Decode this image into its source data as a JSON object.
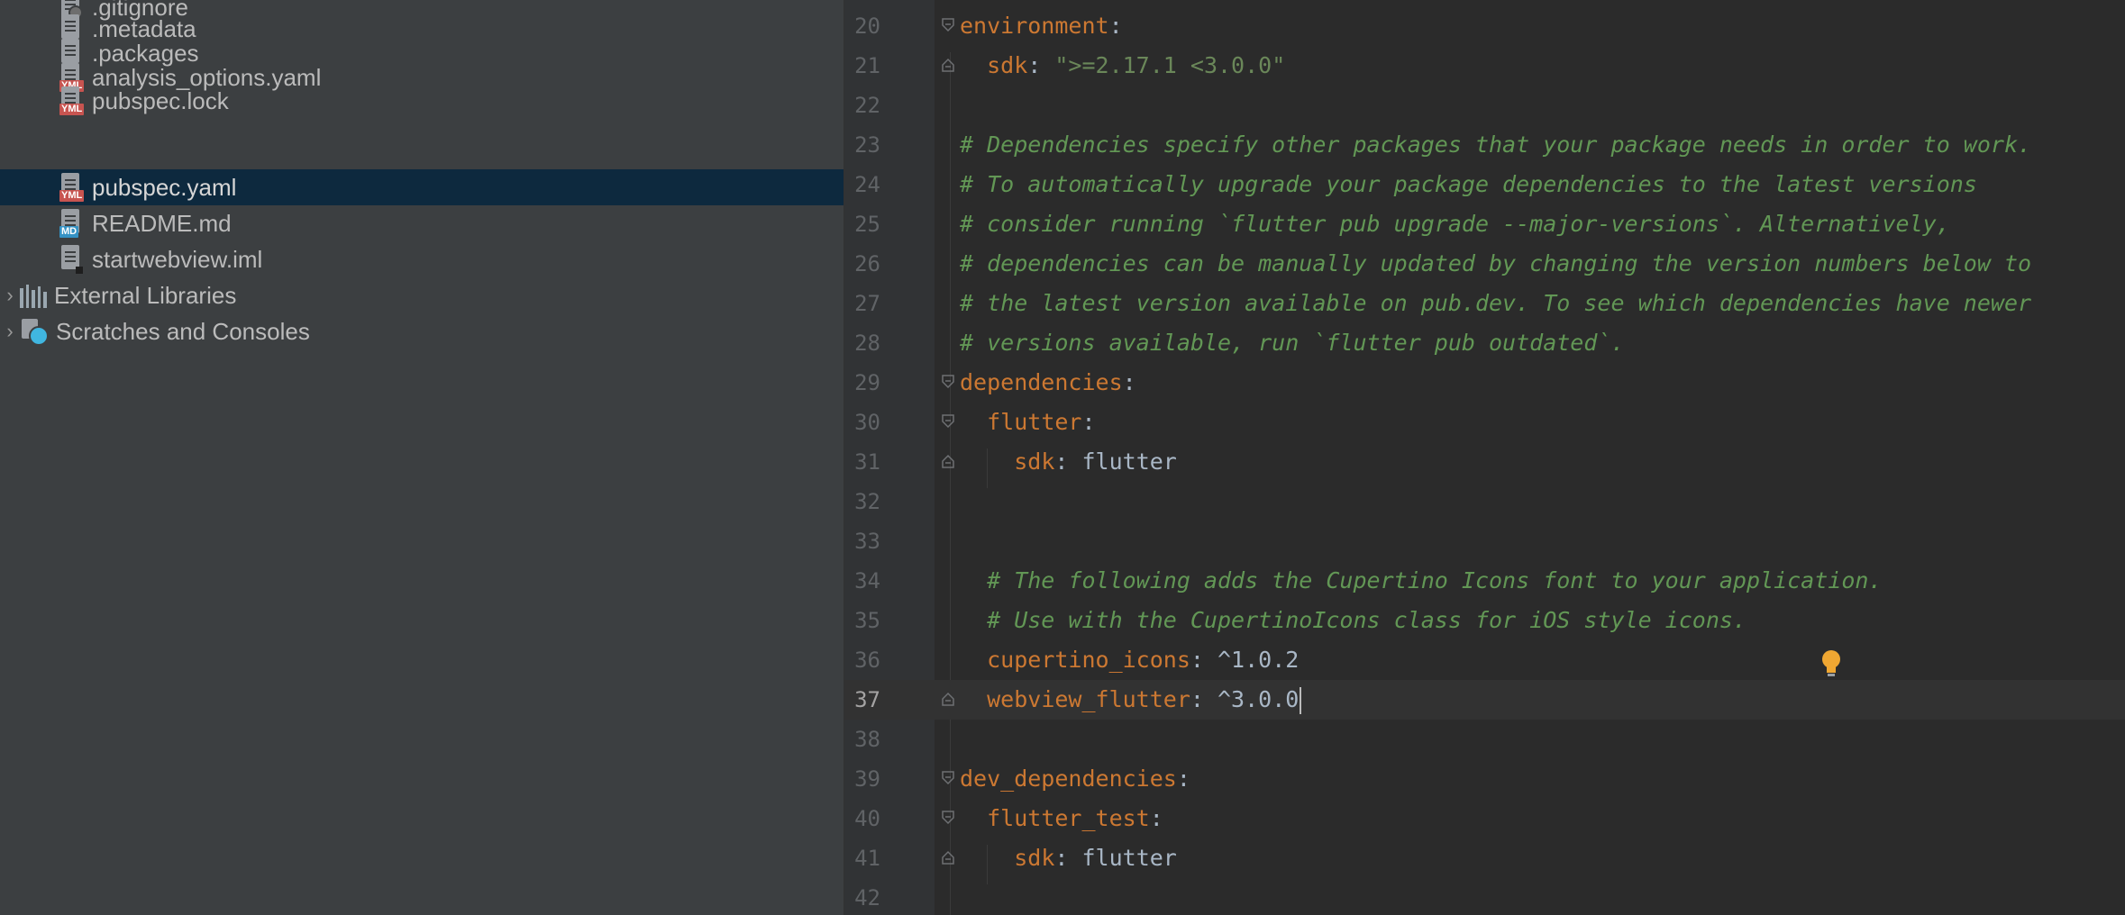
{
  "project_tree": {
    "items": [
      {
        "label": ".gitignore",
        "icon": "gitignore-file-icon"
      },
      {
        "label": ".metadata",
        "icon": "text-file-icon"
      },
      {
        "label": ".packages",
        "icon": "text-file-icon"
      },
      {
        "label": "analysis_options.yaml",
        "icon": "yaml-file-icon",
        "tag": "YML"
      },
      {
        "label": "pubspec.lock",
        "icon": "yaml-file-icon",
        "tag": "YML"
      },
      {
        "label": "pubspec.yaml",
        "icon": "yaml-file-icon",
        "tag": "YML",
        "selected": true
      },
      {
        "label": "README.md",
        "icon": "markdown-file-icon",
        "tag": "MD"
      },
      {
        "label": "startwebview.iml",
        "icon": "iml-file-icon"
      },
      {
        "label": "External Libraries",
        "icon": "library-icon"
      },
      {
        "label": "Scratches and Consoles",
        "icon": "scratches-icon"
      }
    ]
  },
  "editor": {
    "current_line": 37,
    "cursor_position": "end of line 37",
    "lines": [
      {
        "n": "20",
        "text": "environment:"
      },
      {
        "n": "21",
        "text": "  sdk: \">=2.17.1 <3.0.0\""
      },
      {
        "n": "22",
        "text": ""
      },
      {
        "n": "23",
        "text": "# Dependencies specify other packages that your package needs in order to work."
      },
      {
        "n": "24",
        "text": "# To automatically upgrade your package dependencies to the latest versions"
      },
      {
        "n": "25",
        "text": "# consider running `flutter pub upgrade --major-versions`. Alternatively,"
      },
      {
        "n": "26",
        "text": "# dependencies can be manually updated by changing the version numbers below to"
      },
      {
        "n": "27",
        "text": "# the latest version available on pub.dev. To see which dependencies have newer"
      },
      {
        "n": "28",
        "text": "# versions available, run `flutter pub outdated`."
      },
      {
        "n": "29",
        "text": "dependencies:"
      },
      {
        "n": "30",
        "text": "  flutter:"
      },
      {
        "n": "31",
        "text": "    sdk: flutter"
      },
      {
        "n": "32",
        "text": ""
      },
      {
        "n": "33",
        "text": ""
      },
      {
        "n": "34",
        "text": "  # The following adds the Cupertino Icons font to your application."
      },
      {
        "n": "35",
        "text": "  # Use with the CupertinoIcons class for iOS style icons."
      },
      {
        "n": "36",
        "text": "  cupertino_icons: ^1.0.2"
      },
      {
        "n": "37",
        "text": "  webview_flutter: ^3.0.0"
      },
      {
        "n": "38",
        "text": ""
      },
      {
        "n": "39",
        "text": "dev_dependencies:"
      },
      {
        "n": "40",
        "text": "  flutter_test:"
      },
      {
        "n": "41",
        "text": "    sdk: flutter"
      },
      {
        "n": "42",
        "text": ""
      }
    ]
  },
  "colors": {
    "key": "#cc7832",
    "string": "#6a8759",
    "comment": "#629755",
    "plain": "#a9b7c6",
    "selection": "#0d293e",
    "editor_bg": "#2b2b2b",
    "sidebar_bg": "#3c3f41"
  }
}
